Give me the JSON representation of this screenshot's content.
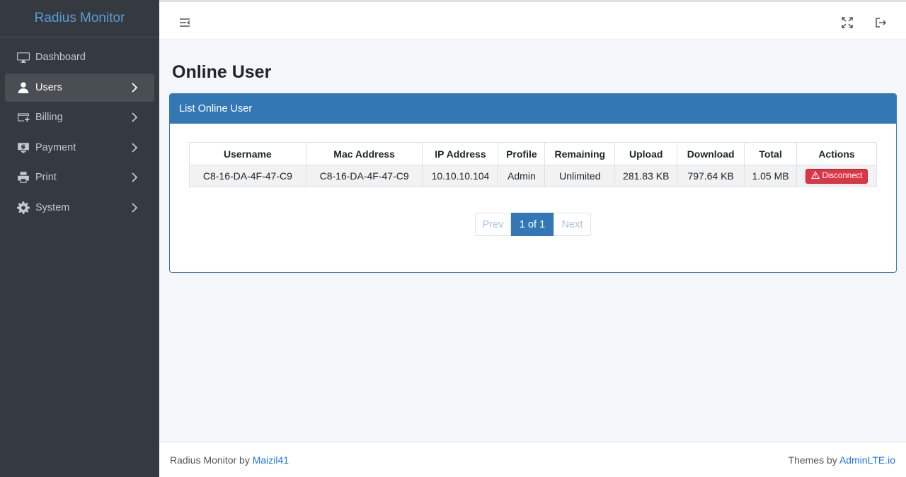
{
  "app": {
    "title": "Radius Monitor"
  },
  "sidebar": {
    "items": [
      {
        "label": "Dashboard",
        "icon": "monitor-icon"
      },
      {
        "label": "Users",
        "icon": "user-icon"
      },
      {
        "label": "Billing",
        "icon": "billing-icon"
      },
      {
        "label": "Payment",
        "icon": "payment-icon"
      },
      {
        "label": "Print",
        "icon": "print-icon"
      },
      {
        "label": "System",
        "icon": "gear-icon"
      }
    ]
  },
  "page": {
    "title": "Online User"
  },
  "card": {
    "header": "List Online User"
  },
  "table": {
    "columns": [
      "Username",
      "Mac Address",
      "IP Address",
      "Profile",
      "Remaining",
      "Upload",
      "Download",
      "Total",
      "Actions"
    ],
    "rows": [
      {
        "username": "C8-16-DA-4F-47-C9",
        "mac": "C8-16-DA-4F-47-C9",
        "ip": "10.10.10.104",
        "profile": "Admin",
        "remaining": "Unlimited",
        "upload": "281.83 KB",
        "download": "797.64 KB",
        "total": "1.05 MB",
        "action": "Disconnect"
      }
    ]
  },
  "pagination": {
    "prev": "Prev",
    "current": "1 of 1",
    "next": "Next"
  },
  "footer": {
    "left_text": "Radius Monitor by",
    "left_link": "Maizil41",
    "right_text": "Themes by",
    "right_link": "AdminLTE.io"
  },
  "colors": {
    "primary": "#3378b5",
    "sidebar": "#343a40",
    "danger": "#dc3545"
  }
}
